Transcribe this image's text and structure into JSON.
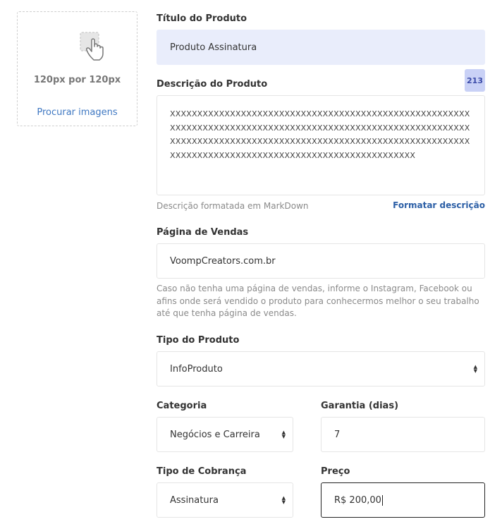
{
  "image_upload": {
    "size_text": "120px por 120px",
    "browse_label": "Procurar imagens"
  },
  "title": {
    "label": "Título do Produto",
    "value": "Produto Assinatura"
  },
  "description": {
    "label": "Descrição do Produto",
    "counter": "213",
    "value": "XXXXXXXXXXXXXXXXXXXXXXXXXXXXXXXXXXXXXXXXXXXXXXXXXXXXXXXXXXXXXXXXXXXXXXXXXXXXXXXXXXXXXXXXXXXXXXXXXXXXXXXXXXXXXXXXXXXXXXXXXXXXXXXXXXXXXXXXXXXXXXXXXXXXXXXXXXXXXXXXXXXXXXXXXXXXXXXXXXXXXXXXXXXXXXXXXXXXXXXXXXXXXXXXXX",
    "hint": "Descrição formatada em MarkDown",
    "format_label": "Formatar descrição"
  },
  "sales_page": {
    "label": "Página de Vendas",
    "value": "VoompCreators.com.br",
    "hint": "Caso não tenha uma página de vendas, informe o Instagram, Facebook ou afins onde será vendido o produto para conhecermos melhor o seu trabalho até que tenha página de vendas."
  },
  "product_type": {
    "label": "Tipo do Produto",
    "value": "InfoProduto"
  },
  "category": {
    "label": "Categoria",
    "value": "Negócios e Carreira"
  },
  "warranty": {
    "label": "Garantia (dias)",
    "value": "7"
  },
  "billing_type": {
    "label": "Tipo de Cobrança",
    "value": "Assinatura"
  },
  "price": {
    "label": "Preço",
    "value": "R$ 200,00"
  },
  "colors": {
    "accent_link": "#3f78c2",
    "counter_bg": "#c9d1f6",
    "title_field_bg": "#e9edfb"
  }
}
